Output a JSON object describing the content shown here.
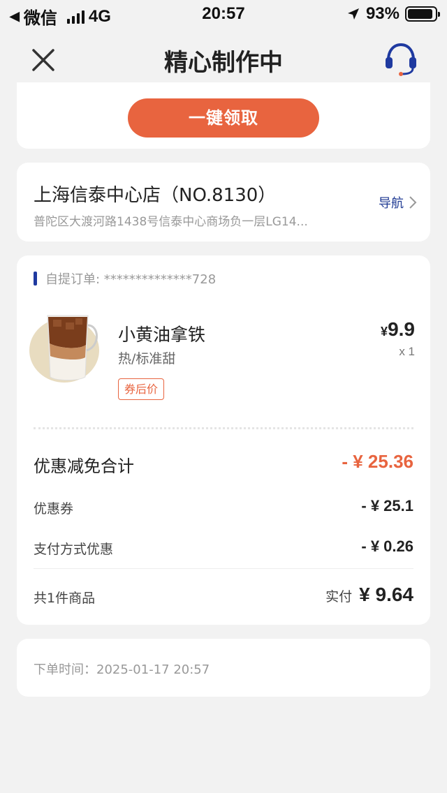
{
  "status_bar": {
    "back_app": "微信",
    "network": "4G",
    "time": "20:57",
    "battery_text": "93%",
    "battery_level": 0.93
  },
  "nav": {
    "title": "精心制作中"
  },
  "claim": {
    "button_label": "一键领取"
  },
  "store": {
    "name": "上海信泰中心店（NO.8130）",
    "address": "普陀区大渡河路1438号信泰中心商场负一层LG14...",
    "nav_label": "导航"
  },
  "order": {
    "tag": "自提订单: **************728",
    "product": {
      "name": "小黄油拿铁",
      "spec": "热/标准甜",
      "badge": "券后价",
      "currency": "¥",
      "price": "9.9",
      "qty": "x 1"
    },
    "discount_total_label": "优惠减免合计",
    "discount_total_value": "- ¥ 25.36",
    "coupon_label": "优惠券",
    "coupon_value": "- ¥ 25.1",
    "pay_discount_label": "支付方式优惠",
    "pay_discount_value": "- ¥ 0.26",
    "items_label": "共1件商品",
    "paid_label": "实付",
    "paid_value": "¥ 9.64"
  },
  "order_time": {
    "text": "下单时间：2025-01-17 20:57"
  },
  "colors": {
    "accent": "#e8643f",
    "brand_blue": "#1f3a93",
    "background": "#f2f2f2"
  }
}
